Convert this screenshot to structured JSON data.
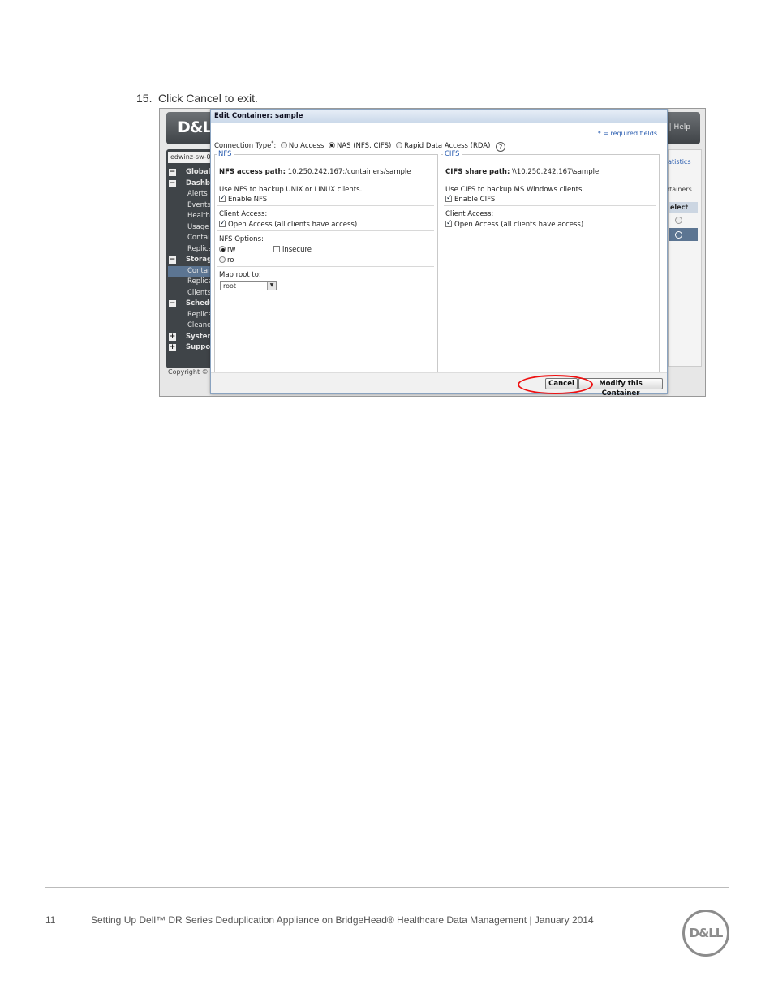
{
  "step": {
    "number": "15.",
    "text": "Click Cancel to exit."
  },
  "app": {
    "logo": "D&LL",
    "help": "| Help",
    "hostname": "edwinz-sw-0",
    "copyright": "Copyright © 2",
    "tree": [
      {
        "label": "Global V",
        "level": "top",
        "toggle": "−"
      },
      {
        "label": "Dashbo",
        "level": "top",
        "toggle": "−"
      },
      {
        "label": "Alerts",
        "level": "sub"
      },
      {
        "label": "Events",
        "level": "sub"
      },
      {
        "label": "Health",
        "level": "sub"
      },
      {
        "label": "Usage",
        "level": "sub"
      },
      {
        "label": "Contair",
        "level": "sub"
      },
      {
        "label": "Replica",
        "level": "sub"
      },
      {
        "label": "Storage",
        "level": "top",
        "toggle": "−"
      },
      {
        "label": "Contain",
        "level": "sub",
        "selected": true
      },
      {
        "label": "Replica",
        "level": "sub"
      },
      {
        "label": "Clients",
        "level": "sub"
      },
      {
        "label": "Schedu",
        "level": "top",
        "toggle": "−"
      },
      {
        "label": "Replica",
        "level": "sub"
      },
      {
        "label": "Cleano",
        "level": "sub"
      },
      {
        "label": "System",
        "level": "top",
        "toggle": "+"
      },
      {
        "label": "Suppor",
        "level": "top",
        "toggle": "+"
      }
    ],
    "right": {
      "statistics": "tatistics",
      "containers": "ntainers",
      "select": "elect"
    }
  },
  "dialog": {
    "title": "Edit Container: sample",
    "required_note": "* = required fields",
    "connection_label": "Connection Type",
    "options": {
      "no_access": "No Access",
      "nas": "NAS (NFS, CIFS)",
      "rda": "Rapid Data Access (RDA)"
    },
    "help_glyph": "?",
    "nfs": {
      "legend": "NFS",
      "path_label": "NFS access path:",
      "path_value": "10.250.242.167:/containers/sample",
      "use_text": "Use NFS to backup UNIX or LINUX clients.",
      "enable": "Enable NFS",
      "client_access": "Client Access:",
      "open_access": "Open Access (all clients have access)",
      "options_label": "NFS Options:",
      "rw": "rw",
      "ro": "ro",
      "insecure": "insecure",
      "map_root": "Map root to:",
      "map_value": "root"
    },
    "cifs": {
      "legend": "CIFS",
      "path_label": "CIFS share path:",
      "path_value": "\\\\10.250.242.167\\sample",
      "use_text": "Use CIFS to backup MS Windows clients.",
      "enable": "Enable CIFS",
      "client_access": "Client Access:",
      "open_access": "Open Access (all clients have access)"
    },
    "buttons": {
      "cancel": "Cancel",
      "modify": "Modify this Container"
    }
  },
  "footer": {
    "page_number": "11",
    "text": "Setting Up Dell™ DR Series Deduplication Appliance on BridgeHead® Healthcare Data Management | January 2014",
    "logo": "D&LL"
  }
}
